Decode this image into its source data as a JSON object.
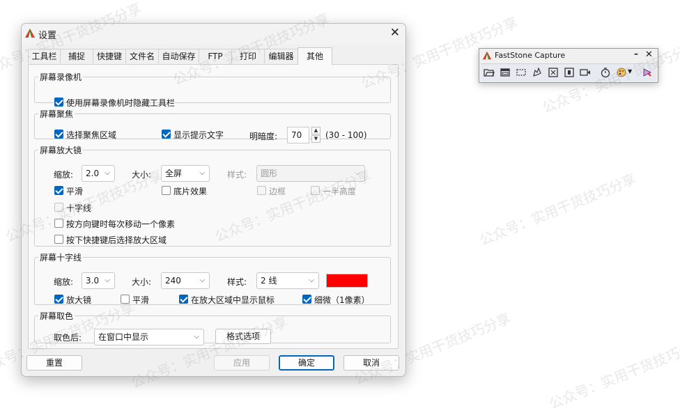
{
  "dialog": {
    "title": "设置",
    "tabs": [
      "工具栏",
      "捕捉",
      "快捷键",
      "文件名",
      "自动保存",
      "FTP",
      "打印",
      "编辑器",
      "其他"
    ],
    "active_tab": "其他",
    "screen_recorder": {
      "legend": "屏幕录像机",
      "hide_toolbar": {
        "label": "使用屏幕录像机时隐藏工具栏",
        "checked": true
      }
    },
    "focus": {
      "legend": "屏幕聚焦",
      "select_region": {
        "label": "选择聚焦区域",
        "checked": true
      },
      "show_hint": {
        "label": "显示提示文字",
        "checked": true
      },
      "brightness_label": "明暗度:",
      "brightness_value": "70",
      "brightness_range": "(30 - 100)"
    },
    "magnifier": {
      "legend": "屏幕放大镜",
      "zoom_label": "缩放:",
      "zoom_value": "2.0",
      "size_label": "大小:",
      "size_value": "全屏",
      "style_label": "样式:",
      "style_value": "圆形",
      "smooth": {
        "label": "平滑",
        "checked": true
      },
      "negative": {
        "label": "底片效果",
        "checked": false
      },
      "border": {
        "label": "边框",
        "checked": false
      },
      "half_height": {
        "label": "一半高度",
        "checked": false
      },
      "crosshair": {
        "label": "十字线",
        "checked": false
      },
      "arrow_move": {
        "label": "按方向键时每次移动一个像素",
        "checked": false
      },
      "hotkey_select": {
        "label": "按下快捷键后选择放大区域",
        "checked": false
      }
    },
    "crosshair": {
      "legend": "屏幕十字线",
      "zoom_label": "缩放:",
      "zoom_value": "3.0",
      "size_label": "大小:",
      "size_value": "240",
      "style_label": "样式:",
      "style_value": "2 线",
      "color": "#ff0000",
      "magnifier": {
        "label": "放大镜",
        "checked": true
      },
      "smooth": {
        "label": "平滑",
        "checked": false
      },
      "show_cursor": {
        "label": "在放大区域中显示鼠标",
        "checked": true
      },
      "thin": {
        "label": "细微（1像素）",
        "checked": true
      }
    },
    "picker": {
      "legend": "屏幕取色",
      "after_label": "取色后:",
      "after_value": "在窗口中显示",
      "format_button": "格式选项"
    },
    "buttons": {
      "reset": "重置",
      "apply": "应用",
      "ok": "确定",
      "cancel": "取消"
    }
  },
  "faststone": {
    "title": "FastStone Capture",
    "min": "–",
    "close": "✕"
  },
  "watermark": "公众号：实用干货技巧分享",
  "colors": {
    "accent": "#0067c0",
    "crosshair": "#ff0000"
  }
}
